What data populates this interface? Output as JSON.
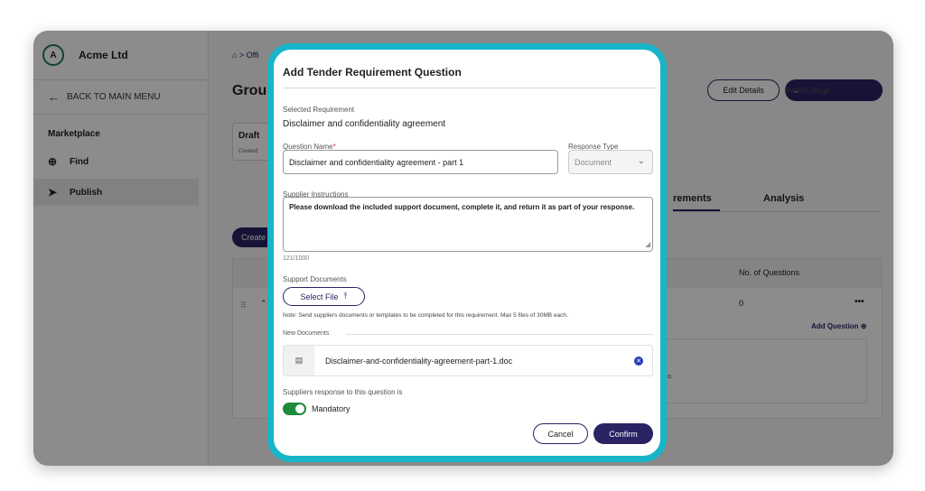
{
  "sidebar": {
    "avatar_letter": "A",
    "org_name": "Acme Ltd",
    "back_label": "BACK TO MAIN MENU",
    "section_label": "Marketplace",
    "items": [
      {
        "label": "Find",
        "icon": "search-plus-icon"
      },
      {
        "label": "Publish",
        "icon": "send-icon"
      }
    ]
  },
  "main": {
    "breadcrumb": "⌂ > Offi",
    "title": "Grou",
    "edit_label": "Edit Details",
    "publish_label": "Publish Stage",
    "draft_label": "Draft",
    "draft_sub": "Created",
    "tabs": [
      {
        "label": "rements"
      },
      {
        "label": "Analysis"
      }
    ],
    "create_label": "Create",
    "table_header": "No. of Questions",
    "row_count": "0",
    "row_menu": "•••",
    "add_question_label": "Add Question",
    "inner_text": "o."
  },
  "modal": {
    "title": "Add Tender Requirement Question",
    "selected_req_label": "Selected Requirement",
    "selected_req_value": "Disclaimer and confidentiality agreement",
    "question_name_label": "Question Name",
    "question_name_value": "Disclaimer and confidentiality agreement - part 1",
    "response_type_label": "Response Type",
    "response_type_value": "Document",
    "instructions_label": "Supplier Instructions",
    "instructions_value": "Please download the included support document, complete it, and return it as part of your response.",
    "char_counter": "121/1000",
    "support_docs_label": "Support Documents",
    "select_file_label": "Select File",
    "note": "Note: Send suppliers documents or templates to be completed for this requirement. Max 5 files of 30MB each.",
    "new_docs_label": "New Documents",
    "doc_name": "Disclaimer-and-confidentiality-agreement-part-1.doc",
    "response_label": "Suppliers response to this question is",
    "mandatory_label": "Mandatory",
    "cancel_label": "Cancel",
    "confirm_label": "Confirm"
  },
  "colors": {
    "accent": "#2a2363",
    "highlight_border": "#17b5c9",
    "toggle_on": "#1e8a3c"
  }
}
